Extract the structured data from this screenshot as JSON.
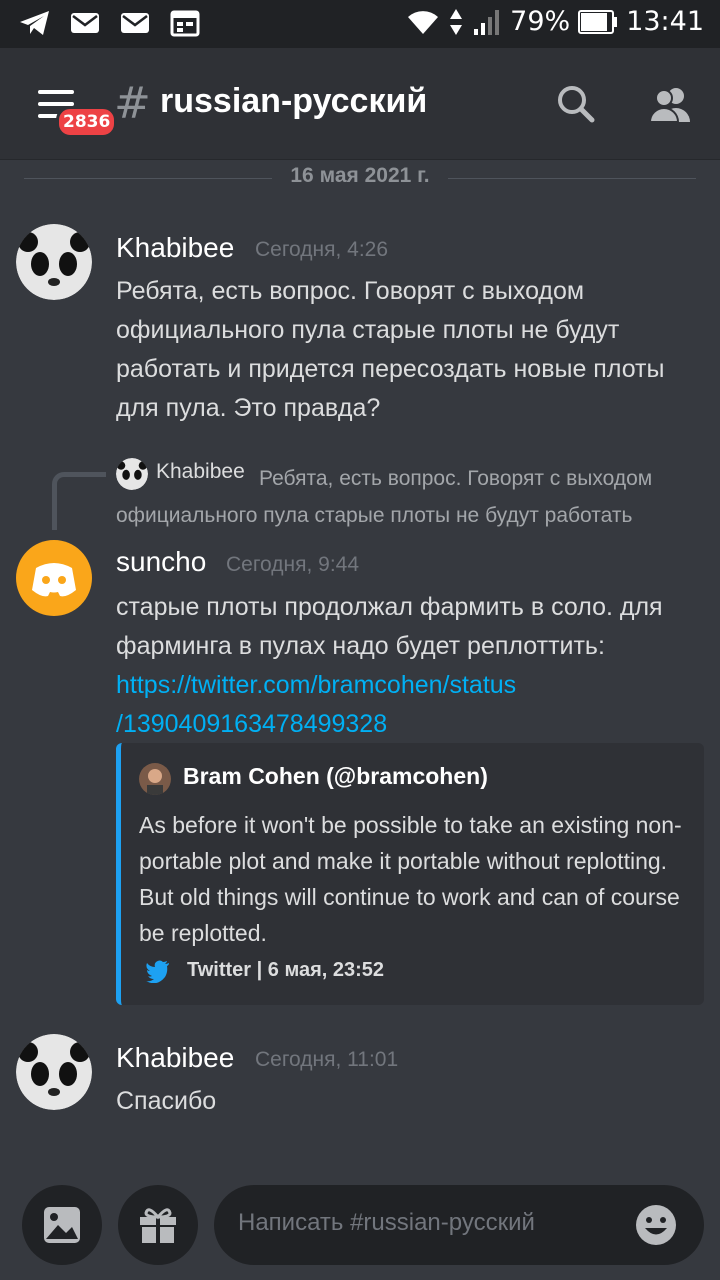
{
  "statusbar": {
    "battery": "79%",
    "time": "13:41"
  },
  "header": {
    "badge": "2836",
    "hash": "#",
    "channel": "russian-русский"
  },
  "date_divider": "16 мая 2021 г.",
  "messages": [
    {
      "user": "Khabibee",
      "time": "Сегодня, 4:26",
      "text": "Ребята, есть вопрос. Говорят с выходом официального пула старые плоты не будут работать и придется пересоздать новые плоты для пула. Это правда?"
    },
    {
      "user": "suncho",
      "time": "Сегодня, 9:44",
      "text": "старые плоты продолжал фармить в соло. для фарминга в пулах надо будет реплоттить: ",
      "link_a": "https://twitter.com/bramcohen/status",
      "link_b": "/1390409163478499328"
    },
    {
      "user": "Khabibee",
      "time": "Сегодня, 11:01",
      "text": "Спасибо"
    }
  ],
  "reply": {
    "user": "Khabibee",
    "text": "Ребята, есть вопрос. Говорят с выходом официального пула старые плоты не будут работать"
  },
  "embed": {
    "author": "Bram Cohen (@bramcohen)",
    "description": "As before it won't be possible to take an existing non-portable plot and make it portable without replotting. But old things will continue to work and can of course be replotted.",
    "footer": "Twitter | 6 мая, 23:52",
    "accent": "#1da1f2"
  },
  "composer": {
    "placeholder": "Написать #russian-русский"
  }
}
